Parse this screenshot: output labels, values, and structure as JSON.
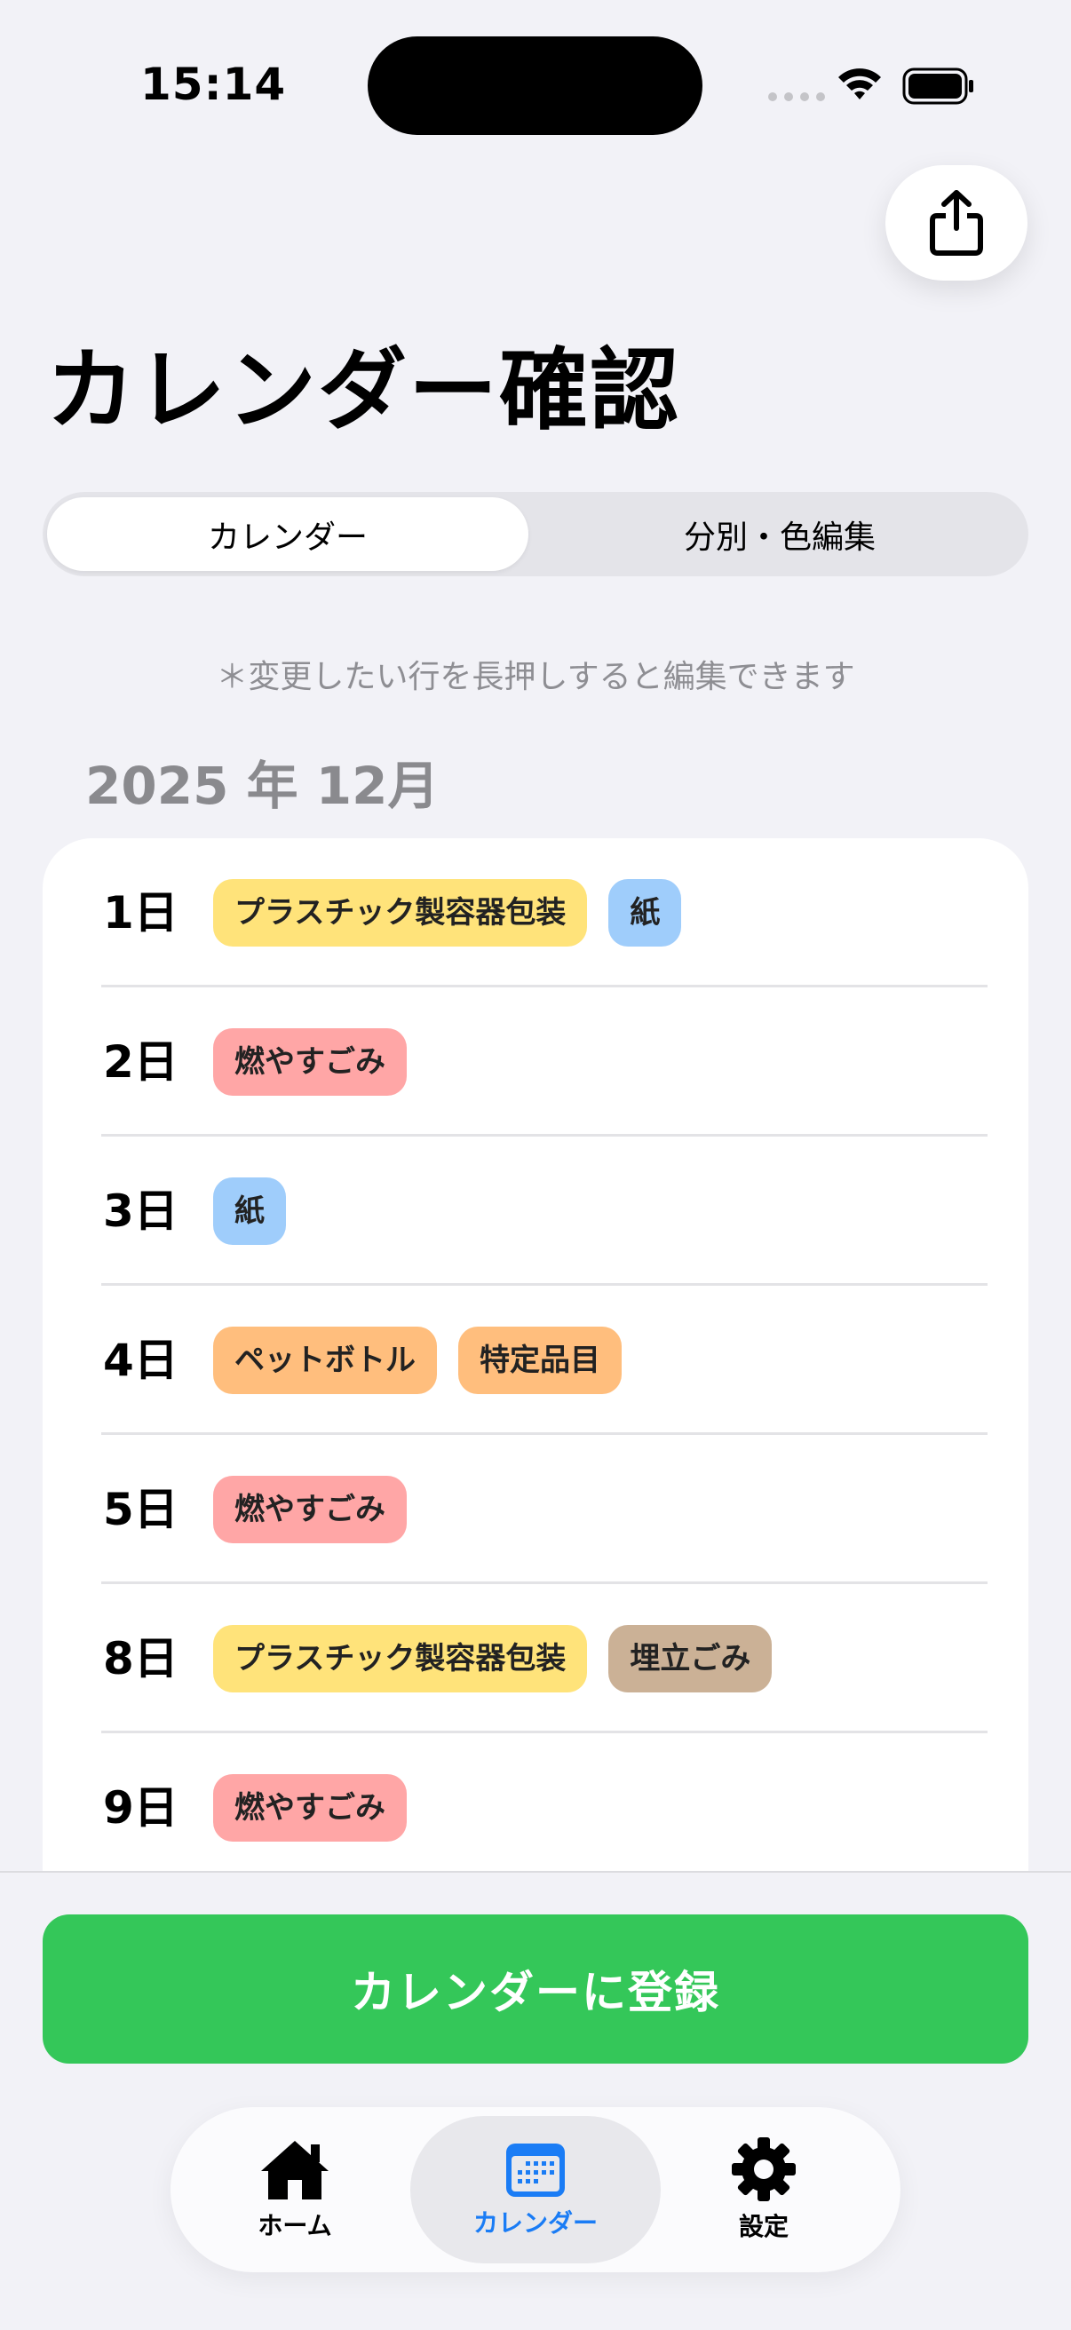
{
  "status_bar": {
    "time": "15:14"
  },
  "header": {
    "title": "カレンダー確認"
  },
  "segments": {
    "calendar": "カレンダー",
    "edit": "分別・色編集"
  },
  "hint": "＊変更したい行を長押しすると編集できます",
  "month": "2025 年 12月",
  "colors": {
    "plastic": "#ffe37a",
    "paper": "#9fcdfb",
    "burnable": "#ffa6a6",
    "pet": "#ffbe7d",
    "landfill": "#cbb196",
    "accent_green": "#34c759",
    "accent_blue": "#1a7cf5"
  },
  "rows": [
    {
      "day": "1日",
      "chips": [
        {
          "label": "プラスチック製容器包装",
          "color": "#ffe37a"
        },
        {
          "label": "紙",
          "color": "#9fcdfb"
        }
      ]
    },
    {
      "day": "2日",
      "chips": [
        {
          "label": "燃やすごみ",
          "color": "#ffa6a6"
        }
      ]
    },
    {
      "day": "3日",
      "chips": [
        {
          "label": "紙",
          "color": "#9fcdfb"
        }
      ]
    },
    {
      "day": "4日",
      "chips": [
        {
          "label": "ペットボトル",
          "color": "#ffbe7d"
        },
        {
          "label": "特定品目",
          "color": "#ffbe7d"
        }
      ]
    },
    {
      "day": "5日",
      "chips": [
        {
          "label": "燃やすごみ",
          "color": "#ffa6a6"
        }
      ]
    },
    {
      "day": "8日",
      "chips": [
        {
          "label": "プラスチック製容器包装",
          "color": "#ffe37a"
        },
        {
          "label": "埋立ごみ",
          "color": "#cbb196"
        }
      ]
    },
    {
      "day": "9日",
      "chips": [
        {
          "label": "燃やすごみ",
          "color": "#ffa6a6"
        }
      ]
    }
  ],
  "register_button": "カレンダーに登録",
  "tabs": {
    "home": "ホーム",
    "calendar": "カレンダー",
    "settings": "設定"
  }
}
